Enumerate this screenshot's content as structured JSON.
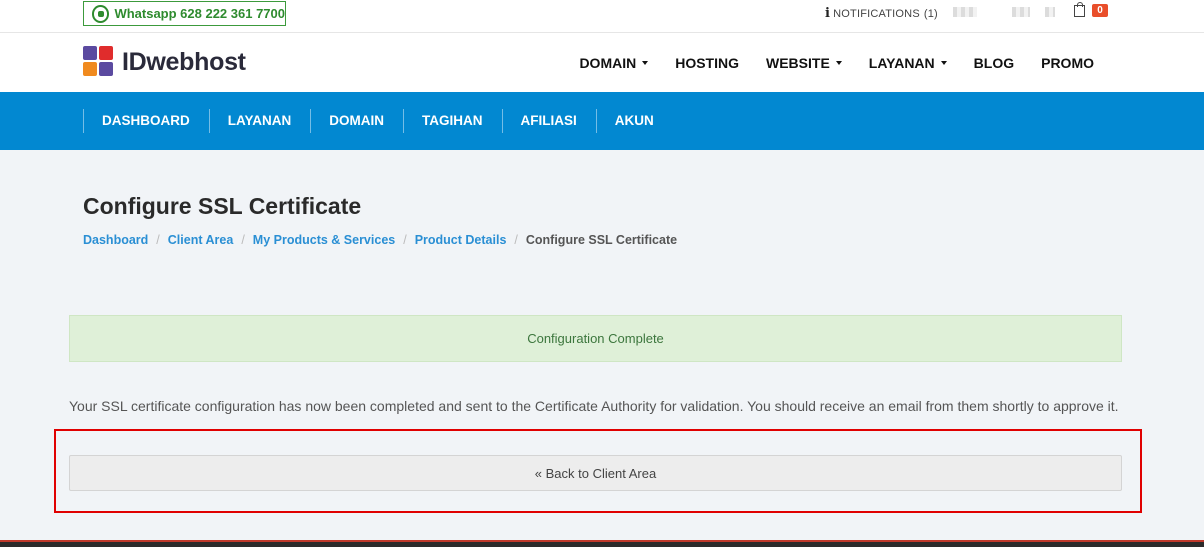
{
  "topbar": {
    "whatsapp_label": "Whatsapp  628 222 361 7700",
    "notifications_label": "NOTIFICATIONS",
    "notifications_count": "(1)",
    "cart_count": "0"
  },
  "header": {
    "logo_text": "IDwebhost",
    "nav": [
      {
        "label": "DOMAIN",
        "dropdown": true
      },
      {
        "label": "HOSTING",
        "dropdown": false
      },
      {
        "label": "WEBSITE",
        "dropdown": true
      },
      {
        "label": "LAYANAN",
        "dropdown": true
      },
      {
        "label": "BLOG",
        "dropdown": false
      },
      {
        "label": "PROMO",
        "dropdown": false
      }
    ]
  },
  "client_nav": [
    "DASHBOARD",
    "LAYANAN",
    "DOMAIN",
    "TAGIHAN",
    "AFILIASI",
    "AKUN"
  ],
  "page": {
    "title": "Configure SSL Certificate",
    "breadcrumb": [
      "Dashboard",
      "Client Area",
      "My Products & Services",
      "Product Details"
    ],
    "breadcrumb_active": "Configure SSL Certificate",
    "alert": "Configuration Complete",
    "description": "Your SSL certificate configuration has now been completed and sent to the Certificate Authority for validation. You should receive an email from them shortly to approve it.",
    "back_button": "« Back to Client Area"
  },
  "colors": {
    "primary_blue": "#0288d1",
    "whatsapp_green": "#2e8b2e",
    "alert_bg": "#dff0d8",
    "alert_text": "#3c763d",
    "link": "#2a8fd4",
    "badge": "#e94e2a",
    "highlight": "#e00000"
  }
}
